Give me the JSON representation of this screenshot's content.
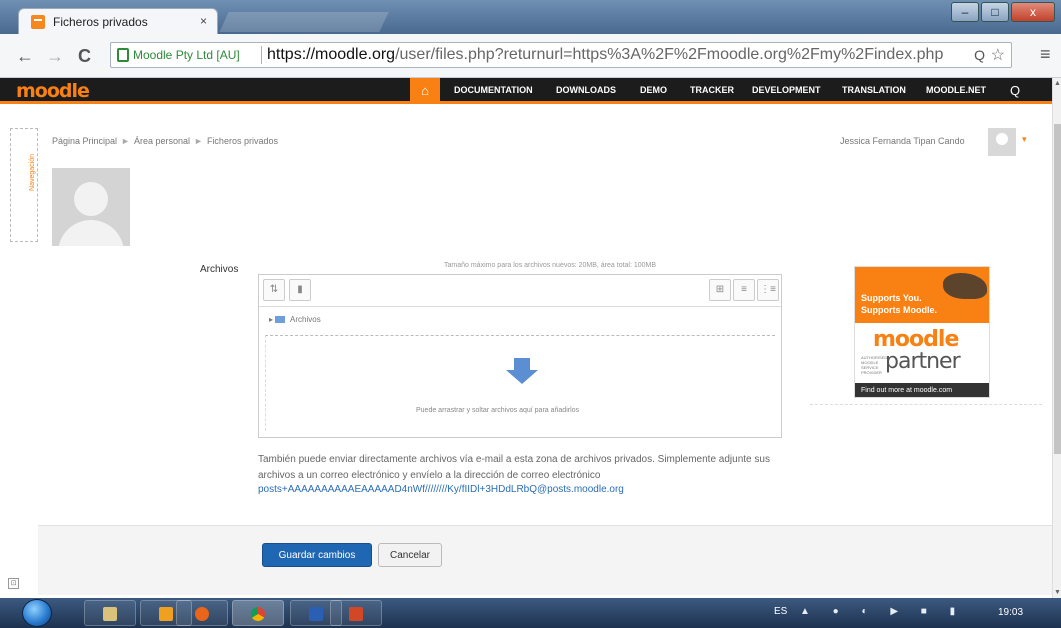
{
  "browser": {
    "tab_title": "Ficheros privados",
    "tab_close": "×",
    "url_identity": "Moodle Pty Ltd [AU]",
    "url_main": "https://moodle.org",
    "url_rest": "/user/files.php?returnurl=https%3A%2F%2Fmoodle.org%2Fmy%2Findex.php",
    "back": "←",
    "forward": "→",
    "reload": "C",
    "zoom_glyph": "Q",
    "star_glyph": "☆",
    "menu_glyph": "≡",
    "window_minimize": "–",
    "window_maximize": "□",
    "window_close": "x"
  },
  "navbar": {
    "logo": "moodle",
    "home_glyph": "⌂",
    "items": [
      "DOCUMENTATION",
      "DOWNLOADS",
      "DEMO",
      "TRACKER",
      "DEVELOPMENT",
      "TRANSLATION",
      "MOODLE.NET"
    ],
    "search_glyph": "Q"
  },
  "page": {
    "dock_label": "Navegación",
    "breadcrumb": [
      "Página Principal",
      "Área personal",
      "Ficheros privados"
    ],
    "breadcrumb_sep": "►",
    "user_name": "Jessica Fernanda Tipan Cando",
    "caret": "▾",
    "field_label": "Archivos",
    "max_size": "Tamaño máximo para los archivos nuevos: 20MB, área total: 100MB",
    "folder_path": "Archivos",
    "path_arrow": "▸",
    "drop_text": "Puede arrastrar y soltar archivos aquí para añadirlos",
    "email_info": "También puede enviar directamente archivos vía e-mail a esta zona de archivos privados. Simplemente adjunte sus archivos a un correo electrónico y envíelo a la dirección de correo electrónico",
    "email_address": "posts+AAAAAAAAAAEAAAAAD4nWf////////Ky/fIIDl+3HDdLRbQ@posts.moodle.org",
    "save_button": "Guardar cambios",
    "cancel_button": "Cancelar",
    "block_glyph": "⊡"
  },
  "toolbar_glyphs": {
    "add": "⇅",
    "folder": "▮",
    "icons_view": "⊞",
    "list_view": "≡",
    "tree_view": "⋮≡"
  },
  "ad": {
    "line1": "Supports You.",
    "line2": "Supports Moodle.",
    "brand": "moodle",
    "partner": "partner",
    "small": "AUTHORISED MOODLE SERVICE PROVIDER",
    "footer": "Find out more at moodle.com"
  },
  "taskbar": {
    "lang": "ES",
    "tray": "▲ ● ◐ ▶ ■ ▮",
    "clock": "19:03"
  },
  "colors": {
    "moodle_orange": "#f98012",
    "navbar_bg": "#1c1c1c",
    "primary_button": "#1f67b3"
  }
}
